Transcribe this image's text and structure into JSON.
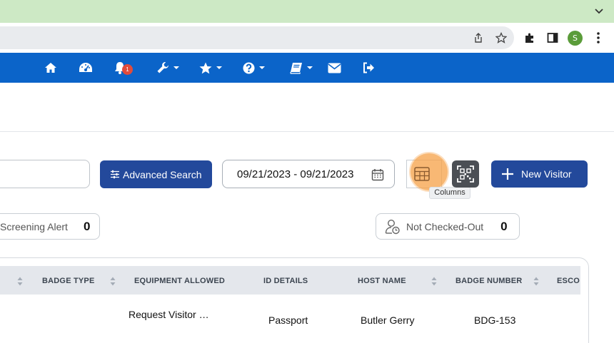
{
  "browser": {
    "profile_initial": "S",
    "icons": [
      "chevron-down-icon",
      "share-icon",
      "star-icon",
      "puzzle-extension-icon",
      "sidebar-icon",
      "more-vert-icon"
    ]
  },
  "nav": {
    "notifications_count": "1",
    "icons": [
      "home-icon",
      "dashboard-gauge-icon",
      "bell-icon",
      "wrench-icon",
      "star-icon",
      "help-icon",
      "book-icon",
      "envelope-icon",
      "sign-out-icon"
    ]
  },
  "toolbar": {
    "advanced_search_label": "Advanced Search",
    "date_range_value": "09/21/2023 - 09/21/2023",
    "columns_tooltip": "Columns",
    "new_visitor_label": "New Visitor"
  },
  "stats": {
    "screening_alert": {
      "label": "Screening Alert",
      "value": "0"
    },
    "not_checked_out": {
      "label": "Not Checked-Out",
      "value": "0"
    }
  },
  "table": {
    "columns": [
      "BADGE TYPE",
      "EQUIPMENT ALLOWED",
      "ID DETAILS",
      "HOST NAME",
      "BADGE NUMBER",
      "ESCO"
    ],
    "rows": [
      {
        "badge_type": "",
        "equipment_allowed": "Request Visitor …",
        "id_details": "Passport",
        "host_name": "Butler Gerry",
        "badge_number": "BDG-153"
      }
    ]
  },
  "colors": {
    "nav_blue": "#0b64c9",
    "primary_button": "#23499b",
    "tab_strip": "#cde9c5",
    "highlight": "#f5a046"
  }
}
